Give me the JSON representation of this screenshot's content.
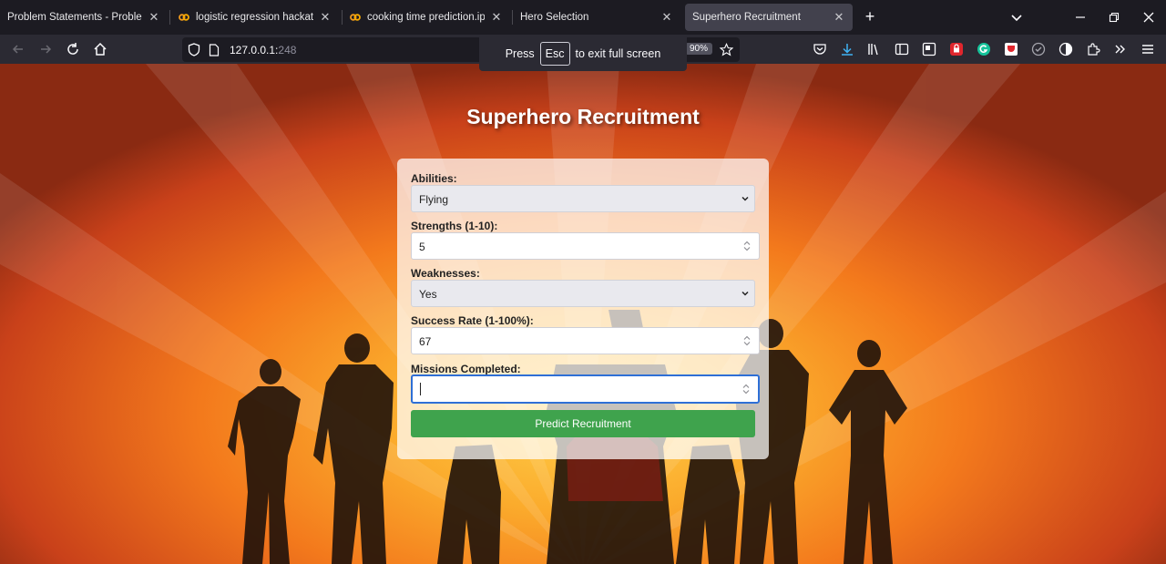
{
  "browser": {
    "tabs": [
      {
        "title": "Problem Statements - Problem Stat",
        "icon": "none",
        "active": false
      },
      {
        "title": "logistic regression hackathon p",
        "icon": "colab-icon",
        "active": false
      },
      {
        "title": "cooking time prediction.ipynb",
        "icon": "colab-icon",
        "active": false
      },
      {
        "title": "Hero Selection",
        "icon": "none",
        "active": false
      },
      {
        "title": "Superhero Recruitment",
        "icon": "none",
        "active": true
      }
    ],
    "url_host": "127.0.0.1:",
    "url_port": "248",
    "zoom": "90%",
    "fullscreen_hint": {
      "press": "Press",
      "key": "Esc",
      "rest": "to exit full screen"
    },
    "accent": "#2e6fd6"
  },
  "page": {
    "title": "Superhero Recruitment",
    "form": {
      "abilities_label": "Abilities:",
      "abilities_value": "Flying",
      "strengths_label": "Strengths (1-10):",
      "strengths_value": "5",
      "weaknesses_label": "Weaknesses:",
      "weaknesses_value": "Yes",
      "success_label": "Success Rate (1-100%):",
      "success_value": "67",
      "missions_label": "Missions Completed:",
      "missions_value": "",
      "submit_label": "Predict Recruitment",
      "submit_color": "#3fa34d"
    }
  }
}
